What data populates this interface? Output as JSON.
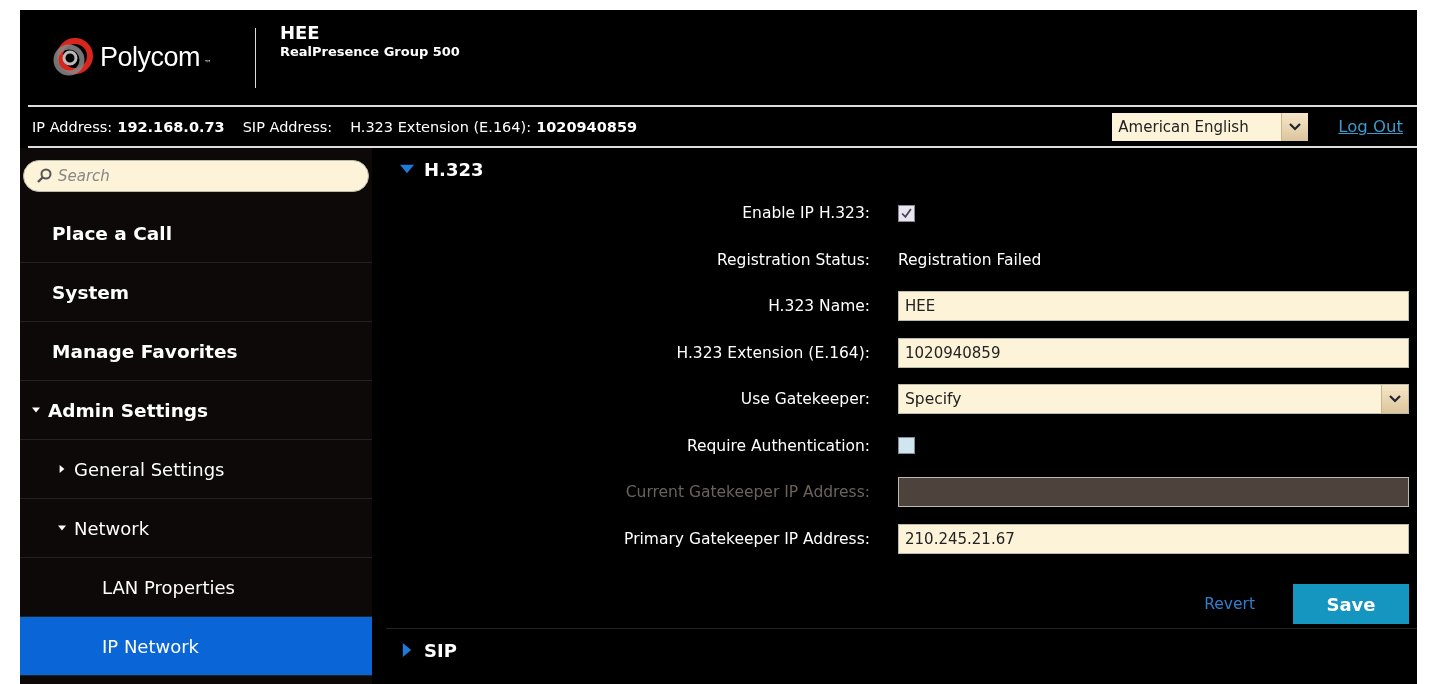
{
  "header": {
    "brand": "Polycom",
    "brand_mark": "™",
    "device_name": "HEE",
    "device_model": "RealPresence Group 500"
  },
  "info_bar": {
    "items": [
      {
        "label": "IP Address:",
        "value": "192.168.0.73"
      },
      {
        "label": "SIP Address:"
      },
      {
        "label": "H.323 Extension (E.164):",
        "value": "1020940859"
      }
    ],
    "language": "American English",
    "logout": "Log Out"
  },
  "sidebar": {
    "search": {
      "placeholder": "Search"
    },
    "items": [
      {
        "label": "Place a Call",
        "selected": false
      },
      {
        "label": "System",
        "selected": false
      },
      {
        "label": "Manage Favorites",
        "selected": false
      },
      {
        "label": "Admin Settings",
        "selected": false,
        "expanded": true,
        "children": [
          {
            "label": "General Settings",
            "selected": false,
            "expanded": false
          },
          {
            "label": "Network",
            "selected": false,
            "expanded": true,
            "children": [
              {
                "label": "LAN Properties",
                "selected": false
              },
              {
                "label": "IP Network",
                "selected": true
              }
            ]
          }
        ]
      }
    ]
  },
  "sections": [
    {
      "title": "H.323",
      "expanded": true,
      "fields": [
        {
          "kind": "checkbox",
          "label": "Enable IP H.323:",
          "checked": true
        },
        {
          "kind": "status",
          "label": "Registration Status:",
          "value": "Registration Failed"
        },
        {
          "kind": "text",
          "label": "H.323 Name:",
          "value": "HEE"
        },
        {
          "kind": "text",
          "label": "H.323 Extension (E.164):",
          "value": "1020940859"
        },
        {
          "kind": "select",
          "label": "Use Gatekeeper:",
          "value": "Specify"
        },
        {
          "kind": "checkbox",
          "label": "Require Authentication:",
          "checked": false
        },
        {
          "kind": "text",
          "label": "Current Gatekeeper IP Address:",
          "disabled": true
        },
        {
          "kind": "text",
          "label": "Primary Gatekeeper IP Address:",
          "value": "210.245.21.67"
        }
      ],
      "revert": "Revert",
      "save": "Save"
    },
    {
      "title": "SIP",
      "expanded": false
    }
  ]
}
